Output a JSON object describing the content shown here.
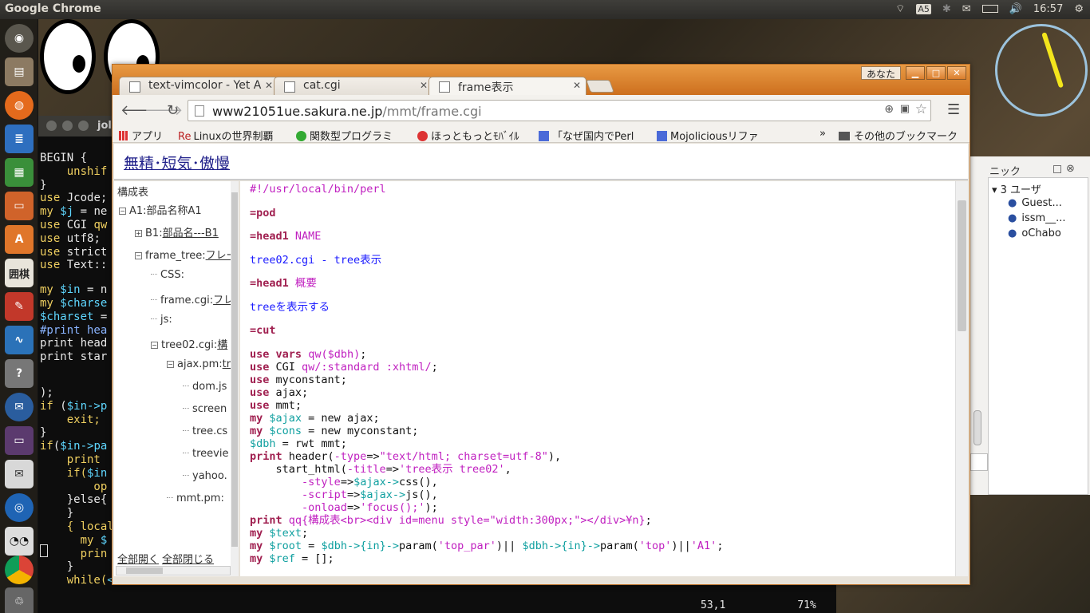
{
  "topbar": {
    "title": "Google Chrome",
    "time": "16:57",
    "tray_icons": [
      "wifi-icon",
      "input-method-icon",
      "bluetooth-icon",
      "mail-icon",
      "battery-icon",
      "volume-icon",
      "settings-icon"
    ],
    "input_method": "A5"
  },
  "launcher": {
    "items": [
      "dash-icon",
      "files-icon",
      "firefox-icon",
      "writer-icon",
      "calc-icon",
      "impress-icon",
      "software-center-icon",
      "go-game-icon",
      "tools-icon",
      "monitor-icon",
      "help-icon",
      "thunderbird-icon",
      "display-icon",
      "mail-app-icon",
      "browser-app-icon",
      "eyes-app-icon",
      "chrome-icon",
      "trash-icon"
    ],
    "go_label": "囲棋"
  },
  "terminal": {
    "title": "jol",
    "lines": [
      [
        {
          "t": "BEGIN {",
          "c": ""
        }
      ],
      [
        {
          "t": "    unshif",
          "c": "kw"
        }
      ],
      [
        {
          "t": "}",
          "c": ""
        }
      ],
      [
        {
          "t": "use",
          "c": "kw"
        },
        {
          "t": " Jcode;",
          "c": ""
        }
      ],
      [
        {
          "t": "my",
          "c": "kw"
        },
        {
          "t": " $j",
          "c": "vr"
        },
        {
          "t": " = ne",
          "c": ""
        }
      ],
      [
        {
          "t": "use",
          "c": "kw"
        },
        {
          "t": " CGI ",
          "c": ""
        },
        {
          "t": "qw",
          "c": "kw"
        }
      ],
      [
        {
          "t": "use",
          "c": "kw"
        },
        {
          "t": " utf8;",
          "c": ""
        }
      ],
      [
        {
          "t": "use",
          "c": "kw"
        },
        {
          "t": " strict",
          "c": ""
        }
      ],
      [
        {
          "t": "use",
          "c": "kw"
        },
        {
          "t": " Text::",
          "c": ""
        }
      ],
      [
        {
          "t": "",
          "c": ""
        }
      ],
      [
        {
          "t": "my",
          "c": "kw"
        },
        {
          "t": " $in",
          "c": "vr"
        },
        {
          "t": " = n",
          "c": ""
        }
      ],
      [
        {
          "t": "my",
          "c": "kw"
        },
        {
          "t": " $charse",
          "c": "vr"
        }
      ],
      [
        {
          "t": "$charset",
          "c": "vr"
        },
        {
          "t": " =",
          "c": ""
        }
      ],
      [
        {
          "t": "#print hea",
          "c": "cm"
        }
      ],
      [
        {
          "t": "print head",
          "c": ""
        }
      ],
      [
        {
          "t": "print star",
          "c": ""
        }
      ],
      [
        {
          "t": "",
          "c": ""
        }
      ],
      [
        {
          "t": "",
          "c": ""
        }
      ],
      [
        {
          "t": ");",
          "c": ""
        }
      ],
      [
        {
          "t": "if",
          "c": "kw"
        },
        {
          "t": " (",
          "c": ""
        },
        {
          "t": "$in->p",
          "c": "vr"
        }
      ],
      [
        {
          "t": "    exit;",
          "c": "kw"
        }
      ],
      [
        {
          "t": "}",
          "c": ""
        }
      ],
      [
        {
          "t": "if",
          "c": "kw"
        },
        {
          "t": "(",
          "c": ""
        },
        {
          "t": "$in->pa",
          "c": "vr"
        }
      ],
      [
        {
          "t": "    print",
          "c": "kw"
        }
      ],
      [
        {
          "t": "    if(",
          "c": "kw"
        },
        {
          "t": "$in",
          "c": "vr"
        }
      ],
      [
        {
          "t": "        op",
          "c": "kw"
        }
      ],
      [
        {
          "t": "    }else{",
          "c": ""
        }
      ],
      [
        {
          "t": "    }",
          "c": ""
        }
      ],
      [
        {
          "t": "    { local",
          "c": "kw"
        }
      ],
      [
        {
          "t": "      my ",
          "c": "kw"
        },
        {
          "t": "$",
          "c": "vr"
        }
      ],
      [
        {
          "t": "      prin",
          "c": "kw"
        }
      ],
      [
        {
          "t": "    }",
          "c": ""
        }
      ],
      [
        {
          "t": "    while(",
          "c": "kw"
        },
        {
          "t": "<FILE>",
          "c": "vr"
        },
        {
          "t": "){",
          "c": ""
        }
      ]
    ],
    "status_pos": "53,1",
    "status_pct": "71%"
  },
  "chat": {
    "header": "ニック",
    "group": "3 ユーザ",
    "users": [
      "Guest...",
      "issm__...",
      "oChabo"
    ]
  },
  "browser": {
    "tabs": [
      {
        "label": "text-vimcolor - Yet A"
      },
      {
        "label": "cat.cgi"
      },
      {
        "label": "frame表示",
        "active": true
      }
    ],
    "profile_label": "あなた",
    "url_host": "www21051ue.sakura.ne.jp",
    "url_path": "/mmt/frame.cgi",
    "bookmarks": [
      "アプリ",
      "Linuxの世界制覇",
      "関数型プログラミ",
      "ほっともっとﾓﾊﾞｲﾙ",
      "「なぜ国内でPerl",
      "Mojoliciousリファ"
    ],
    "bookmarks_more": "»",
    "other_bookmarks": "その他のブックマーク",
    "page_title": "無精･短気･傲慢",
    "tree": {
      "header": "構成表",
      "nodes": [
        {
          "label": "A1:部品名称A1",
          "link": "",
          "level": 0,
          "box": "minus"
        },
        {
          "label": "B1:",
          "link": "部品名---B1",
          "level": 1,
          "box": "plus"
        },
        {
          "label": "frame_tree:",
          "link": "フレー",
          "level": 1,
          "box": "minus"
        },
        {
          "label": "CSS:",
          "link": "",
          "level": 2,
          "box": ""
        },
        {
          "label": "frame.cgi:",
          "link": "フレ",
          "level": 2,
          "box": ""
        },
        {
          "label": "js:",
          "link": "",
          "level": 2,
          "box": ""
        },
        {
          "label": "tree02.cgi:",
          "link": "構",
          "level": 2,
          "box": "minus"
        },
        {
          "label": "ajax.pm:",
          "link": "tr",
          "level": 3,
          "box": "minus"
        },
        {
          "label": "dom.js",
          "link": "",
          "level": 4,
          "box": ""
        },
        {
          "label": "screen",
          "link": "",
          "level": 4,
          "box": ""
        },
        {
          "label": "tree.cs",
          "link": "",
          "level": 4,
          "box": ""
        },
        {
          "label": "treevie",
          "link": "",
          "level": 4,
          "box": ""
        },
        {
          "label": "yahoo.",
          "link": "",
          "level": 4,
          "box": ""
        },
        {
          "label": "mmt.pm:",
          "link": "",
          "level": 3,
          "box": ""
        }
      ],
      "open_all": "全部開く",
      "close_all": "全部閉じる"
    },
    "code_lines": [
      [
        {
          "t": "#!/usr/local/bin/perl",
          "c": "mag"
        }
      ],
      [
        {
          "t": "",
          "c": ""
        }
      ],
      [
        {
          "t": "=pod",
          "c": "pod"
        }
      ],
      [
        {
          "t": "",
          "c": ""
        }
      ],
      [
        {
          "t": "=head1",
          "c": "pod"
        },
        {
          "t": " NAME",
          "c": "mag"
        }
      ],
      [
        {
          "t": "",
          "c": ""
        }
      ],
      [
        {
          "t": "tree02.cgi - tree表示",
          "c": "blu"
        }
      ],
      [
        {
          "t": "",
          "c": ""
        }
      ],
      [
        {
          "t": "=head1",
          "c": "pod"
        },
        {
          "t": " 概要",
          "c": "mag"
        }
      ],
      [
        {
          "t": "",
          "c": ""
        }
      ],
      [
        {
          "t": "treeを表示する",
          "c": "blu"
        }
      ],
      [
        {
          "t": "",
          "c": ""
        }
      ],
      [
        {
          "t": "=cut",
          "c": "pod"
        }
      ],
      [
        {
          "t": "",
          "c": ""
        }
      ],
      [
        {
          "t": "use",
          "c": "kwd"
        },
        {
          "t": " ",
          "c": ""
        },
        {
          "t": "vars",
          "c": "kwd"
        },
        {
          "t": " ",
          "c": ""
        },
        {
          "t": "qw($dbh)",
          "c": "str"
        },
        {
          "t": ";",
          "c": ""
        }
      ],
      [
        {
          "t": "use",
          "c": "kwd"
        },
        {
          "t": " CGI ",
          "c": ""
        },
        {
          "t": "qw/:standard :xhtml/",
          "c": "str"
        },
        {
          "t": ";",
          "c": ""
        }
      ],
      [
        {
          "t": "use",
          "c": "kwd"
        },
        {
          "t": " myconstant;",
          "c": ""
        }
      ],
      [
        {
          "t": "use",
          "c": "kwd"
        },
        {
          "t": " ajax;",
          "c": ""
        }
      ],
      [
        {
          "t": "use",
          "c": "kwd"
        },
        {
          "t": " mmt;",
          "c": ""
        }
      ],
      [
        {
          "t": "my",
          "c": "kwd"
        },
        {
          "t": " ",
          "c": ""
        },
        {
          "t": "$ajax",
          "c": "var"
        },
        {
          "t": " = new ajax;",
          "c": ""
        }
      ],
      [
        {
          "t": "my",
          "c": "kwd"
        },
        {
          "t": " ",
          "c": ""
        },
        {
          "t": "$cons",
          "c": "var"
        },
        {
          "t": " = new myconstant;",
          "c": ""
        }
      ],
      [
        {
          "t": "$dbh",
          "c": "var"
        },
        {
          "t": " = rwt mmt;",
          "c": ""
        }
      ],
      [
        {
          "t": "print",
          "c": "kwd"
        },
        {
          "t": " header(",
          "c": ""
        },
        {
          "t": "-type",
          "c": "str"
        },
        {
          "t": "=>",
          "c": ""
        },
        {
          "t": "\"text/html; charset=utf-8\"",
          "c": "str"
        },
        {
          "t": "),",
          "c": ""
        }
      ],
      [
        {
          "t": "    start_html(",
          "c": ""
        },
        {
          "t": "-title",
          "c": "str"
        },
        {
          "t": "=>",
          "c": ""
        },
        {
          "t": "'tree表示 tree02'",
          "c": "str"
        },
        {
          "t": ",",
          "c": ""
        }
      ],
      [
        {
          "t": "        ",
          "c": ""
        },
        {
          "t": "-style",
          "c": "str"
        },
        {
          "t": "=>",
          "c": ""
        },
        {
          "t": "$ajax->",
          "c": "var"
        },
        {
          "t": "css(),",
          "c": ""
        }
      ],
      [
        {
          "t": "        ",
          "c": ""
        },
        {
          "t": "-script",
          "c": "str"
        },
        {
          "t": "=>",
          "c": ""
        },
        {
          "t": "$ajax->",
          "c": "var"
        },
        {
          "t": "js(),",
          "c": ""
        }
      ],
      [
        {
          "t": "        ",
          "c": ""
        },
        {
          "t": "-onload",
          "c": "str"
        },
        {
          "t": "=>",
          "c": ""
        },
        {
          "t": "'focus();'",
          "c": "str"
        },
        {
          "t": ");",
          "c": ""
        }
      ],
      [
        {
          "t": "print",
          "c": "kwd"
        },
        {
          "t": " ",
          "c": ""
        },
        {
          "t": "qq{構成表<br><div id=menu style=\"width:300px;\"></div>¥n}",
          "c": "str"
        },
        {
          "t": ";",
          "c": ""
        }
      ],
      [
        {
          "t": "my",
          "c": "kwd"
        },
        {
          "t": " ",
          "c": ""
        },
        {
          "t": "$text",
          "c": "var"
        },
        {
          "t": ";",
          "c": ""
        }
      ],
      [
        {
          "t": "my",
          "c": "kwd"
        },
        {
          "t": " ",
          "c": ""
        },
        {
          "t": "$root",
          "c": "var"
        },
        {
          "t": " = ",
          "c": ""
        },
        {
          "t": "$dbh->{in}->",
          "c": "var"
        },
        {
          "t": "param(",
          "c": ""
        },
        {
          "t": "'top_par'",
          "c": "str"
        },
        {
          "t": ")|| ",
          "c": ""
        },
        {
          "t": "$dbh->{in}->",
          "c": "var"
        },
        {
          "t": "param(",
          "c": ""
        },
        {
          "t": "'top'",
          "c": "str"
        },
        {
          "t": ")||",
          "c": ""
        },
        {
          "t": "'A1'",
          "c": "str"
        },
        {
          "t": ";",
          "c": ""
        }
      ],
      [
        {
          "t": "my",
          "c": "kwd"
        },
        {
          "t": " ",
          "c": ""
        },
        {
          "t": "$ref",
          "c": "var"
        },
        {
          "t": " = [];",
          "c": ""
        }
      ]
    ]
  }
}
